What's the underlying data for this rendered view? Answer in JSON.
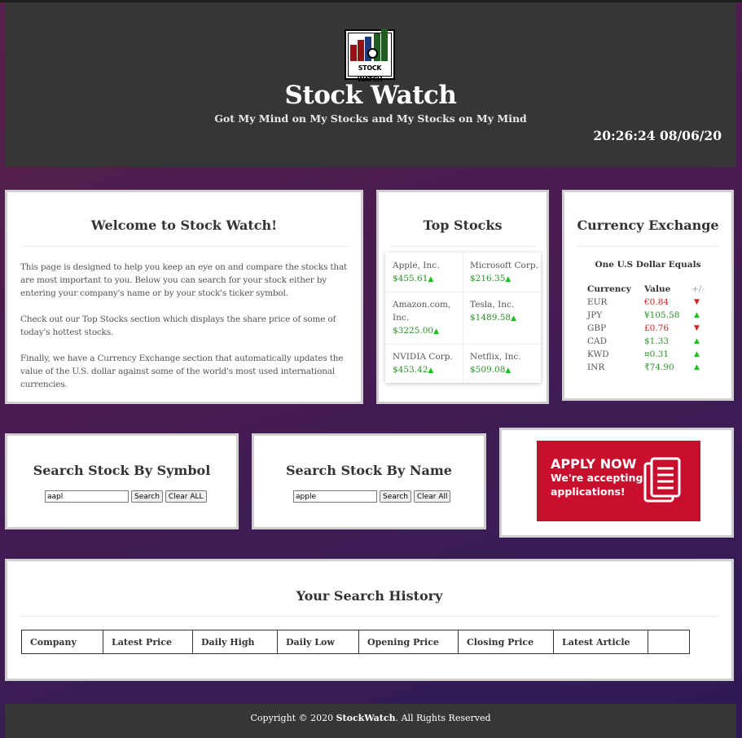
{
  "header": {
    "logo_text": "STOCK WATCH",
    "title": "Stock Watch",
    "subtitle": "Got My Mind on My Stocks and My Stocks on My Mind",
    "clock": "20:26:24 08/06/20"
  },
  "welcome": {
    "heading": "Welcome to Stock Watch!",
    "paragraphs": [
      "This page is designed to help you keep an eye on and compare the stocks that are most important to you. Below you can search for your stock either by entering your company's name or by your stock's ticker symbol.",
      "Check out our Top Stocks section which displays the share price of some of today's hottest stocks.",
      "Finally, we have a Currency Exchange section that automatically updates the value of the U.S. dollar against some of the world's most used international currencies."
    ]
  },
  "top_stocks": {
    "heading": "Top Stocks",
    "items": [
      {
        "name": "Apple, Inc.",
        "price": "$455.61",
        "trend": "up"
      },
      {
        "name": "Microsoft Corp.",
        "price": "$216.35",
        "trend": "up"
      },
      {
        "name": "Amazon.com, Inc.",
        "price": "$3225.00",
        "trend": "up"
      },
      {
        "name": "Tesla, Inc.",
        "price": "$1489.58",
        "trend": "up"
      },
      {
        "name": "NVIDIA Corp.",
        "price": "$453.42",
        "trend": "up"
      },
      {
        "name": "Netflix, Inc.",
        "price": "$509.08",
        "trend": "up"
      }
    ]
  },
  "currency": {
    "heading": "Currency Exchange",
    "subheading": "One U.S Dollar Equals",
    "columns": [
      "Currency",
      "Value",
      "+/-"
    ],
    "rows": [
      {
        "code": "EUR",
        "value": "€0.84",
        "trend": "down"
      },
      {
        "code": "JPY",
        "value": "¥105.58",
        "trend": "up"
      },
      {
        "code": "GBP",
        "value": "£0.76",
        "trend": "down"
      },
      {
        "code": "CAD",
        "value": "$1.33",
        "trend": "up"
      },
      {
        "code": "KWD",
        "value": "¤0.31",
        "trend": "up"
      },
      {
        "code": "INR",
        "value": "₹74.90",
        "trend": "up"
      }
    ],
    "colors": {
      "up": "#1bbf1b",
      "down": "#d21f1f"
    }
  },
  "search_symbol": {
    "heading": "Search Stock By Symbol",
    "value": "aapl",
    "search_label": "Search",
    "clear_label": "Clear ALL"
  },
  "search_name": {
    "heading": "Search Stock By Name",
    "value": "apple",
    "search_label": "Search",
    "clear_label": "Clear All"
  },
  "apply": {
    "line1": "APPLY NOW",
    "line2": "We're accepting",
    "line3": "applications!",
    "icon": "document-icon",
    "color": "#c8102e"
  },
  "history": {
    "heading": "Your Search History",
    "columns": [
      "Company",
      "Latest Price",
      "Daily High",
      "Daily Low",
      "Opening Price",
      "Closing Price",
      "Latest Article",
      ""
    ]
  },
  "footer": {
    "prefix": "Copyright © 2020 ",
    "brand": "StockWatch",
    "suffix": ". All Rights Reserved"
  }
}
